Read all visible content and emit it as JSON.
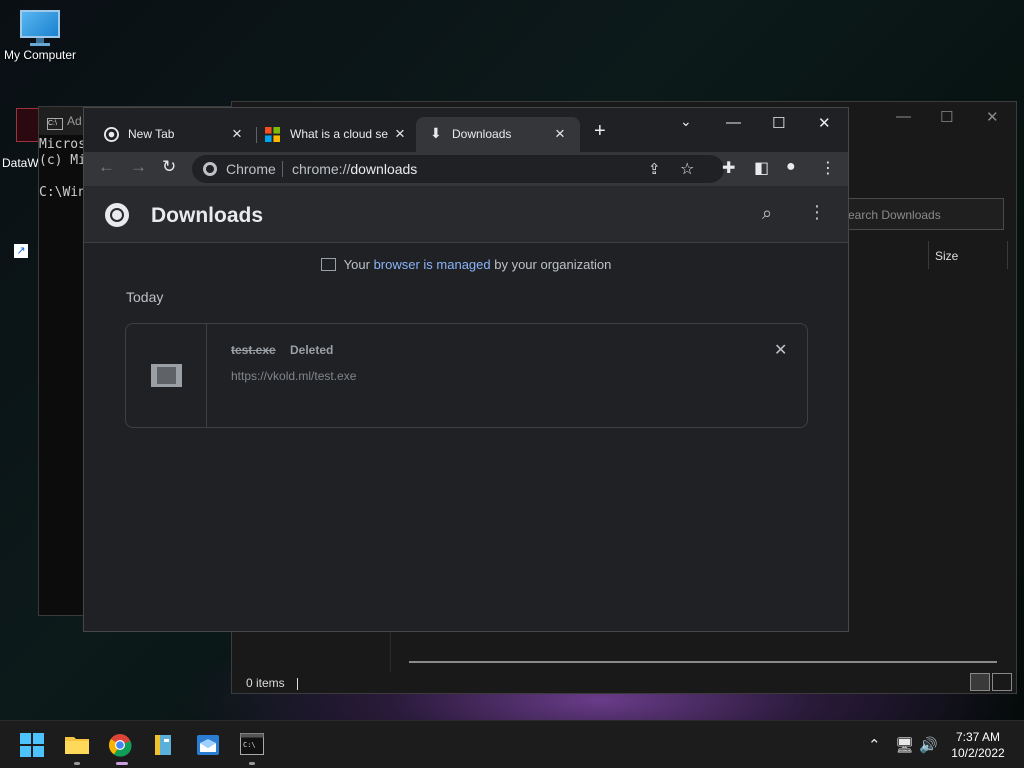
{
  "desktop": {
    "icons": [
      {
        "label": "My Computer"
      },
      {
        "label": "DataW"
      }
    ]
  },
  "cmd": {
    "title": "Ad",
    "lines": [
      "Micros",
      "(c) Mi",
      "",
      "C:\\Win"
    ]
  },
  "explorer": {
    "search_placeholder": "earch Downloads",
    "column_size": "Size",
    "status_items": "0 items"
  },
  "chrome": {
    "tabs": [
      {
        "title": "New Tab",
        "active": false
      },
      {
        "title": "What is a cloud se",
        "active": false
      },
      {
        "title": "Downloads",
        "active": true
      }
    ],
    "omnibox": {
      "label": "Chrome",
      "url_scheme": "chrome://",
      "url_host": "downloads"
    },
    "page": {
      "title": "Downloads",
      "managed_prefix": "Your ",
      "managed_link": "browser is managed",
      "managed_suffix": " by your organization",
      "section": "Today",
      "items": [
        {
          "filename": "test.exe",
          "status": "Deleted",
          "url": "https://vkold.ml/test.exe"
        }
      ]
    }
  },
  "taskbar": {
    "time": "7:37 AM",
    "date": "10/2/2022"
  },
  "colors": {
    "accent": "#8ab4f8",
    "chrome_dark": "#202124",
    "toolbar": "#35363a",
    "start_blue": "#4cc2ff"
  }
}
